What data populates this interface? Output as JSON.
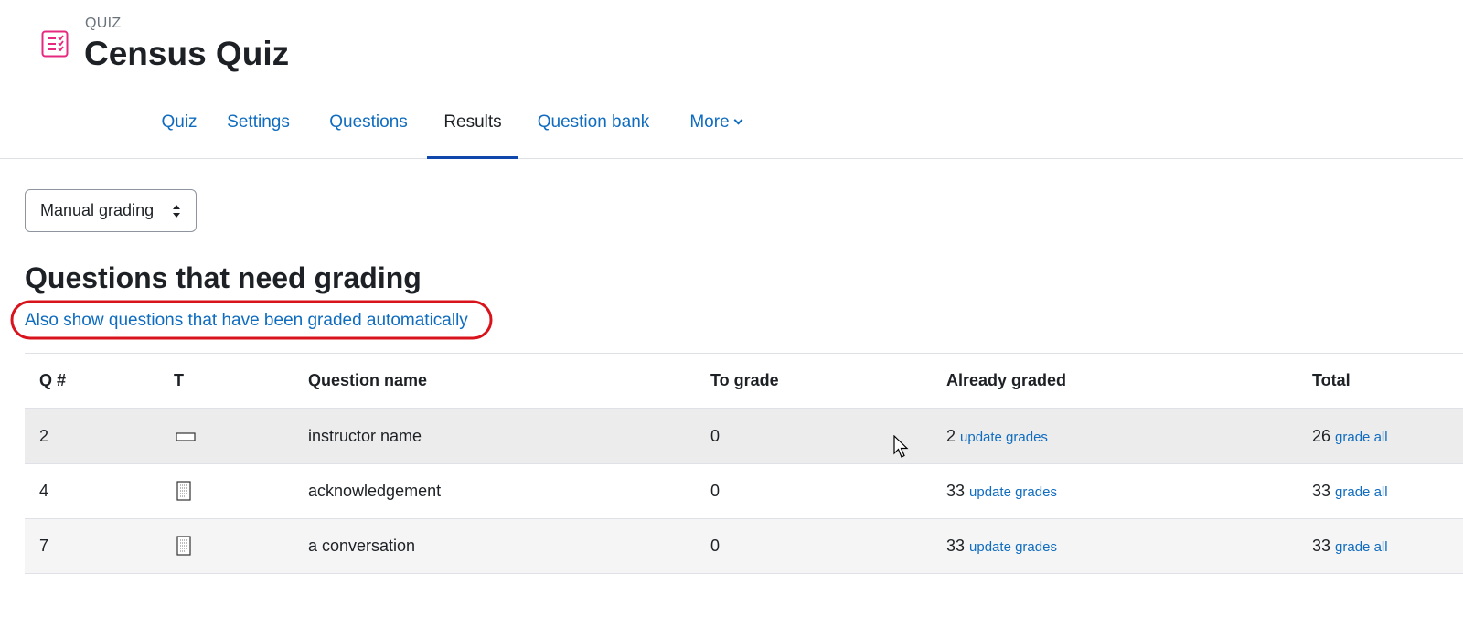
{
  "header": {
    "activity_label": "QUIZ",
    "title": "Census Quiz",
    "icon": "quiz-icon",
    "icon_color": "#e6287e"
  },
  "tabs": [
    {
      "label": "Quiz",
      "active": false
    },
    {
      "label": "Settings",
      "active": false
    },
    {
      "label": "Questions",
      "active": false
    },
    {
      "label": "Results",
      "active": true
    },
    {
      "label": "Question bank",
      "active": false
    },
    {
      "label": "More",
      "active": false
    }
  ],
  "grading_select": {
    "value": "Manual grading"
  },
  "section": {
    "title": "Questions that need grading",
    "also_show_link": "Also show questions that have been graded automatically",
    "highlight_color": "#d9131b"
  },
  "table": {
    "headers": [
      "Q #",
      "T",
      "Question name",
      "To grade",
      "Already graded",
      "Total"
    ],
    "rows": [
      {
        "qnum": "2",
        "type_icon": "short-answer-icon",
        "name": "instructor name",
        "to_grade": "0",
        "already_graded": "2",
        "already_link": "update grades",
        "total": "26",
        "total_link": "grade all"
      },
      {
        "qnum": "4",
        "type_icon": "essay-icon",
        "name": "acknowledgement",
        "to_grade": "0",
        "already_graded": "33",
        "already_link": "update grades",
        "total": "33",
        "total_link": "grade all"
      },
      {
        "qnum": "7",
        "type_icon": "essay-icon",
        "name": "a conversation",
        "to_grade": "0",
        "already_graded": "33",
        "already_link": "update grades",
        "total": "33",
        "total_link": "grade all"
      }
    ]
  },
  "colors": {
    "link": "#0f6cbf",
    "active_tab_underline": "#0f47ad",
    "text": "#1d2125"
  }
}
